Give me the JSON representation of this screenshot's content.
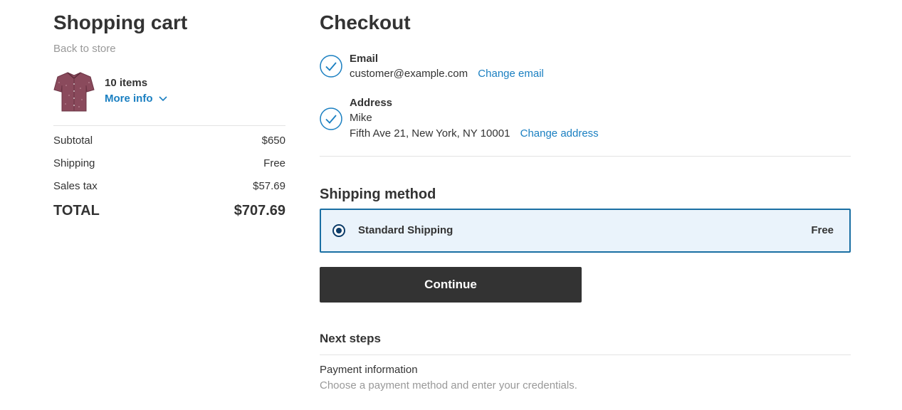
{
  "cart": {
    "title": "Shopping cart",
    "back_link": "Back to store",
    "product_icon": "shirt-image",
    "items_count": "10 items",
    "more_info": "More info",
    "summary": {
      "subtotal_label": "Subtotal",
      "subtotal_value": "$650",
      "shipping_label": "Shipping",
      "shipping_value": "Free",
      "tax_label": "Sales tax",
      "tax_value": "$57.69",
      "total_label": "TOTAL",
      "total_value": "$707.69"
    }
  },
  "checkout": {
    "title": "Checkout",
    "email": {
      "label": "Email",
      "value": "customer@example.com",
      "change_link": "Change email"
    },
    "address": {
      "label": "Address",
      "name": "Mike",
      "line": "Fifth Ave 21, New York, NY 10001",
      "change_link": "Change address"
    },
    "shipping_method": {
      "title": "Shipping method",
      "option_name": "Standard Shipping",
      "option_price": "Free",
      "selected": true
    },
    "continue_label": "Continue",
    "next_steps": {
      "title": "Next steps",
      "step_title": "Payment information",
      "step_desc": "Choose a payment method and enter your credentials."
    }
  },
  "colors": {
    "accent_link": "#1a7fc1",
    "selected_border": "#1a6fa3",
    "selected_bg": "#eaf3fb",
    "button_bg": "#333333",
    "muted_text": "#999999"
  }
}
